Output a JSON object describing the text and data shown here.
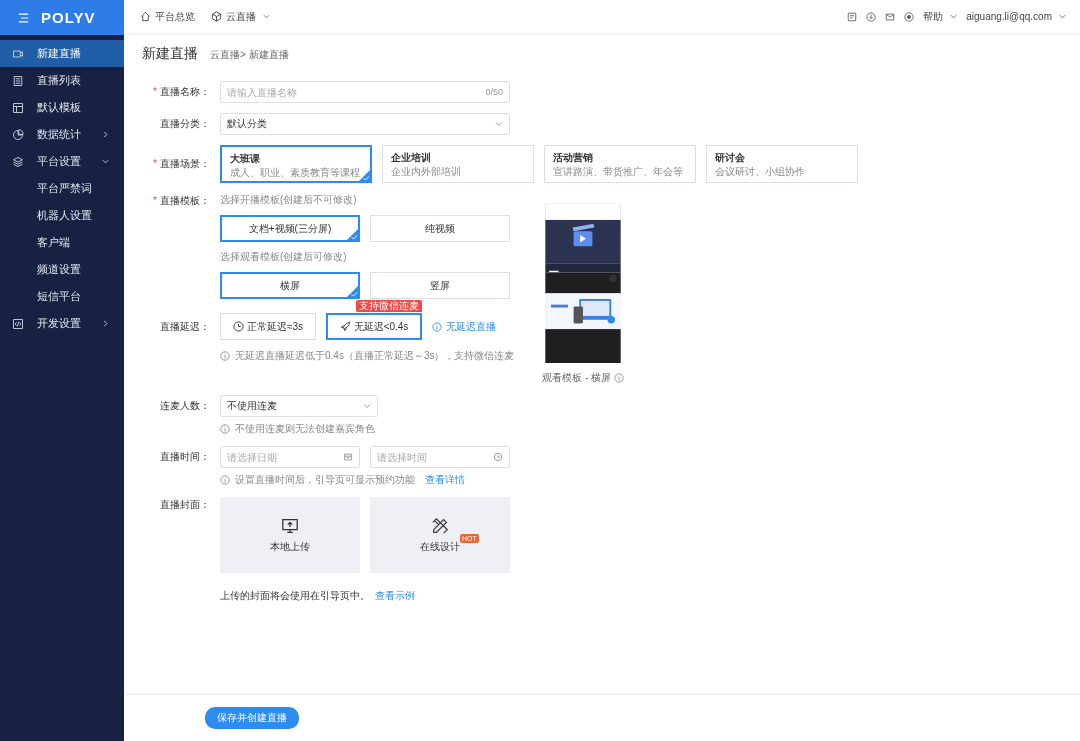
{
  "sidebar": {
    "logo": "POLYV",
    "items": [
      {
        "label": "新建直播",
        "selected": true
      },
      {
        "label": "直播列表",
        "selected": false
      },
      {
        "label": "默认模板",
        "selected": false
      },
      {
        "label": "数据统计",
        "selected": false,
        "expanded": false
      },
      {
        "label": "平台设置",
        "selected": false,
        "expanded": true,
        "children": [
          {
            "label": "平台严禁词",
            "selected": false
          },
          {
            "label": "机器人设置",
            "selected": false
          },
          {
            "label": "客户端",
            "selected": false
          },
          {
            "label": "频道设置",
            "selected": false
          },
          {
            "label": "短信平台",
            "selected": false
          }
        ]
      },
      {
        "label": "开发设置",
        "selected": false,
        "expanded": false
      }
    ]
  },
  "topbar": {
    "nav": [
      {
        "label": "平台总览",
        "dropdown": false
      },
      {
        "label": "云直播",
        "dropdown": true
      }
    ],
    "help": "帮助",
    "user": "aiguang.li@qq.com"
  },
  "page": {
    "title": "新建直播",
    "breadcrumb": "云直播> 新建直播"
  },
  "form": {
    "name": {
      "mark": "*",
      "label": "直播名称：",
      "placeholder": "请输入直播名称",
      "counter": "0/50"
    },
    "category": {
      "label": "直播分类：",
      "value": "默认分类"
    },
    "scene": {
      "mark": "*",
      "label": "直播场景：",
      "options": [
        {
          "title": "大班课",
          "desc": "成人、职业、素质教育等课程",
          "selected": true
        },
        {
          "title": "企业培训",
          "desc": "企业内外部培训",
          "selected": false
        },
        {
          "title": "活动营销",
          "desc": "宣讲路演、带货推广、年会等",
          "selected": false
        },
        {
          "title": "研讨会",
          "desc": "会议研讨、小组协作",
          "selected": false
        }
      ]
    },
    "template": {
      "mark": "*",
      "label": "直播模板：",
      "start_hint": "选择开播模板(创建后不可修改)",
      "start_options": [
        {
          "label": "文档+视频(三分屏)",
          "selected": true
        },
        {
          "label": "纯视频",
          "selected": false
        }
      ],
      "watch_hint": "选择观看模板(创建后可修改)",
      "watch_options": [
        {
          "label": "横屏",
          "selected": true
        },
        {
          "label": "竖屏",
          "selected": false
        }
      ],
      "preview_caption": "观看模板 - 横屏"
    },
    "delay": {
      "label": "直播延迟：",
      "options": [
        {
          "label": "正常延迟≈3s",
          "selected": false
        },
        {
          "label": "无延迟<0.4s",
          "selected": true,
          "badge": "支持微信连麦"
        }
      ],
      "link": "无延迟直播",
      "hint": "无延迟直播延迟低于0.4s（直播正常延迟～3s），支持微信连麦"
    },
    "mic": {
      "label": "连麦人数：",
      "value": "不使用连麦",
      "hint": "不使用连麦则无法创建嘉宾角色"
    },
    "time": {
      "label": "直播时间：",
      "date_placeholder": "请选择日期",
      "time_placeholder": "请选择时间",
      "hint": "设置直播时间后，引导页可显示预约功能",
      "link": "查看详情"
    },
    "cover": {
      "label": "直播封面：",
      "options": [
        {
          "label": "本地上传"
        },
        {
          "label": "在线设计",
          "badge": "HOT"
        }
      ],
      "note": "上传的封面将会使用在引导页中。",
      "link": "查看示例"
    }
  },
  "save_button": "保存并创建直播"
}
